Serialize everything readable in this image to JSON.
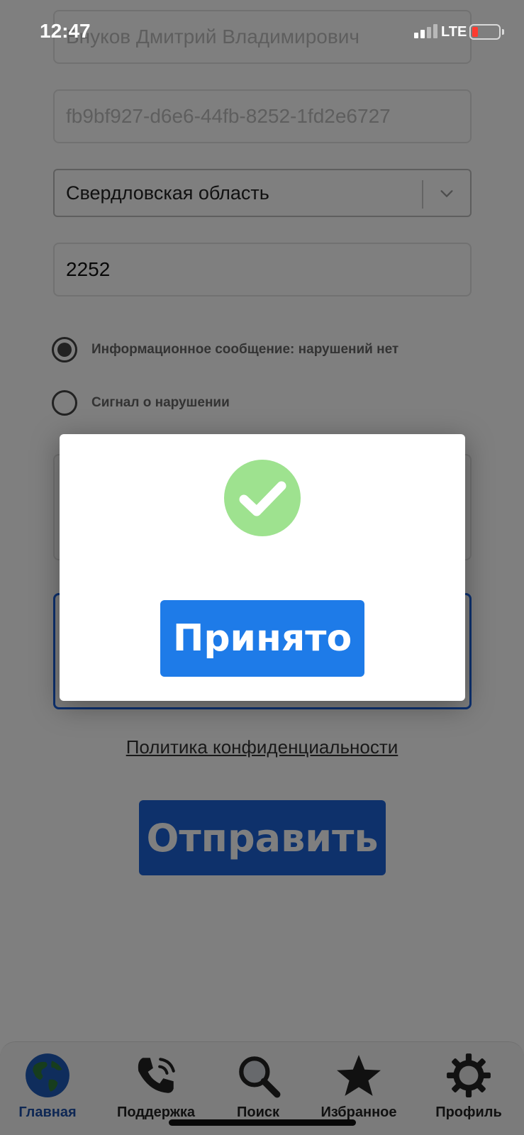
{
  "status_bar": {
    "time": "12:47",
    "network": "LTE",
    "battery_level": "low"
  },
  "form": {
    "full_name": "Внуков Дмитрий Владимирович",
    "id": "fb9bf927-d6e6-44fb-8252-1fd2e6727",
    "region": "Свердловская область",
    "code": "2252",
    "radio_options": [
      {
        "label": "Информационное сообщение: нарушений нет",
        "selected": true
      },
      {
        "label": "Сигнал о нарушении",
        "selected": false
      }
    ],
    "privacy_link": "Политика конфиденциальности",
    "send_label": "Отправить"
  },
  "modal": {
    "icon": "check-circle-icon",
    "icon_color": "#9ee28f",
    "button_label": "Принято",
    "button_color": "#1e7be8"
  },
  "tabbar": {
    "items": [
      {
        "label": "Главная",
        "icon": "globe-icon",
        "active": true
      },
      {
        "label": "Поддержка",
        "icon": "phone-icon",
        "active": false
      },
      {
        "label": "Поиск",
        "icon": "search-icon",
        "active": false
      },
      {
        "label": "Избранное",
        "icon": "star-icon",
        "active": false
      },
      {
        "label": "Профиль",
        "icon": "gear-icon",
        "active": false
      }
    ]
  },
  "colors": {
    "accent": "#1c63d6",
    "overlay": "rgba(0,0,0,0.5)",
    "active_tab": "#1c4fa8"
  }
}
